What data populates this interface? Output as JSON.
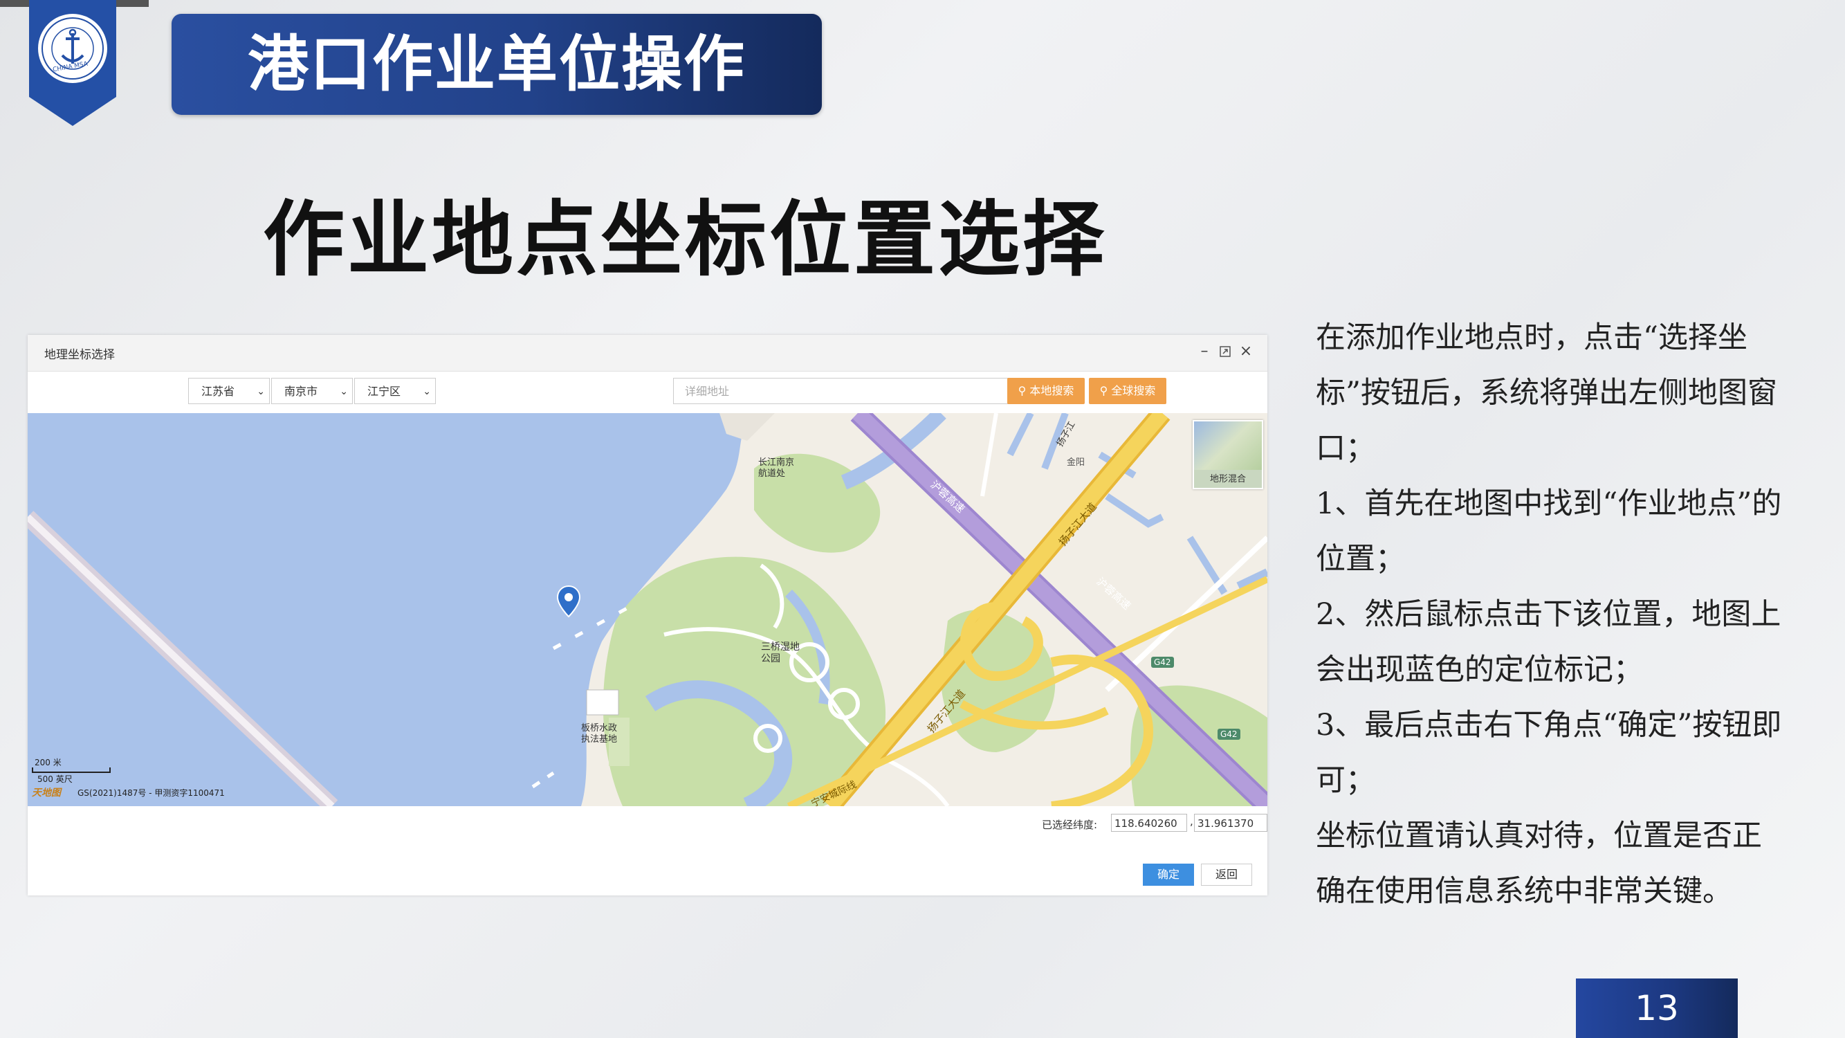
{
  "logo": {
    "text": "CHINA MSA",
    "ring_text": "中国海事局"
  },
  "header": {
    "title": "港口作业单位操作"
  },
  "heading": "作业地点坐标位置选择",
  "dialog": {
    "title": "地理坐标选择",
    "province": "江苏省",
    "city": "南京市",
    "district": "江宁区",
    "address_placeholder": "详细地址",
    "local_search": "本地搜索",
    "global_search": "全球搜索",
    "coord_label": "已选经纬度:",
    "longitude": "118.640260",
    "latitude": "31.961370",
    "confirm": "确定",
    "back": "返回"
  },
  "map": {
    "labels": {
      "nav_office": "长江南京\n航道处",
      "jinli": "金阳",
      "yangzi_river_top": "扬子江",
      "hushan_expressway": "沪蓉高速",
      "wetland_park": "三桥湿地\n公园",
      "yangzijiang_avenue": "扬子江大道",
      "yangzijiang_avenue_2": "扬子江大道",
      "g42": "G42",
      "g42_2": "G42",
      "water_base": "板桥水政\n执法基地",
      "rail_line": "宁安城际线",
      "terrain": "地形混合",
      "scale_m": "200 米",
      "scale_ft": "500 英尺",
      "approval": "GS(2021)1487号 - 甲测资字1100471",
      "brand": "天地图"
    },
    "colors": {
      "water": "#a9c2ea",
      "land": "#f2eee6",
      "green": "#c8dfa8",
      "road_yellow": "#f5d45c",
      "expressway": "#b39ddb"
    }
  },
  "description": [
    "在添加作业地点时，点击“选择坐标”按钮后，系统将弹出左侧地图窗口；",
    "1、首先在地图中找到“作业地点”的位置；",
    "2、然后鼠标点击下该位置，地图上会出现蓝色的定位标记；",
    "3、最后点击右下角点“确定”按钮即可；",
    "坐标位置请认真对待，位置是否正确在使用信息系统中非常关键。"
  ],
  "page_number": "13"
}
